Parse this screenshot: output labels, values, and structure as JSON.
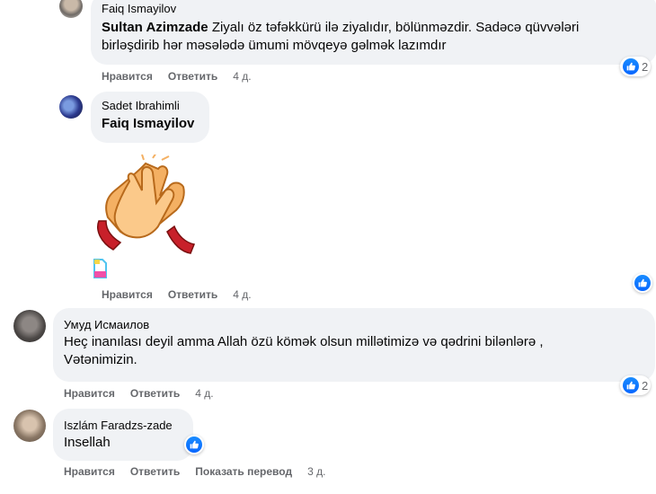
{
  "comments": [
    {
      "author": "Faiq Ismayilov",
      "mention": "Sultan Azimzade",
      "text_line1": "Ziyalı öz təfəkkürü ilə ziyalıdır, bölünməzdir. Sadəcə qüvvələri",
      "text_line2": "birləşdirib hər məsələdə ümumi mövqeyə gəlmək lazımdır",
      "like_label": "Нравится",
      "reply_label": "Ответить",
      "time": "4 д.",
      "reaction_count": "2"
    },
    {
      "author": "Sadet Ibrahimli",
      "mention": "Faiq Ismayilov",
      "like_label": "Нравится",
      "reply_label": "Ответить",
      "time": "4 д.",
      "sticker": "applause-hands-sticker"
    },
    {
      "author": "Умуд Исмаилов",
      "text_line1": "Heç inanılası deyil amma Allah özü kömək olsun millətimizə və qədrini bilənlərə ,",
      "text_line2": "Vətənimizin.",
      "like_label": "Нравится",
      "reply_label": "Ответить",
      "time": "4 д.",
      "reaction_count": "2"
    },
    {
      "author": "Iszlám Faradzs-zade",
      "text": "Insellah",
      "like_label": "Нравится",
      "reply_label": "Ответить",
      "translate_label": "Показать перевод",
      "time": "3 д."
    }
  ],
  "colors": {
    "bubble": "#f0f2f5",
    "action_text": "#65676b",
    "like_blue": "#0866ff"
  },
  "icons": [
    "like-icon",
    "file-icon"
  ]
}
